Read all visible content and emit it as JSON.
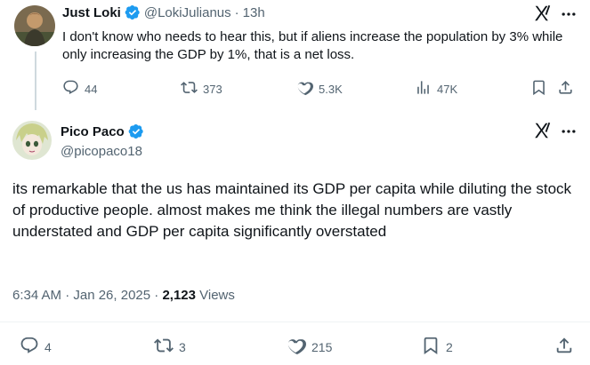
{
  "tweet1": {
    "author_name": "Just Loki",
    "handle": "@LokiJulianus",
    "separator": "·",
    "time": "13h",
    "text": "I don't know who needs to hear this, but if aliens increase the population by 3% while only increasing the GDP by 1%, that is a net loss.",
    "replies": "44",
    "reposts": "373",
    "likes": "5.3K",
    "views": "47K"
  },
  "tweet2": {
    "author_name": "Pico Paco",
    "handle": "@picopaco18",
    "text": "its remarkable that the us has maintained its GDP per capita while diluting the stock of productive people. almost makes me think the illegal numbers are vastly understated and GDP per capita significantly overstated",
    "timestamp": "6:34 AM · Jan 26, 2025 · ",
    "views_count": "2,123",
    "views_label": " Views",
    "replies": "4",
    "reposts": "3",
    "likes": "215",
    "bookmarks": "2"
  },
  "colors": {
    "text_primary": "#0f1419",
    "text_secondary": "#536471",
    "verified_blue": "#1d9bf0",
    "divider": "#eff3f4",
    "thread_line": "#cfd9de"
  },
  "icons": [
    "verified-badge-icon",
    "grok-icon",
    "more-icon",
    "reply-icon",
    "repost-icon",
    "like-icon",
    "views-icon",
    "bookmark-icon",
    "share-icon"
  ]
}
